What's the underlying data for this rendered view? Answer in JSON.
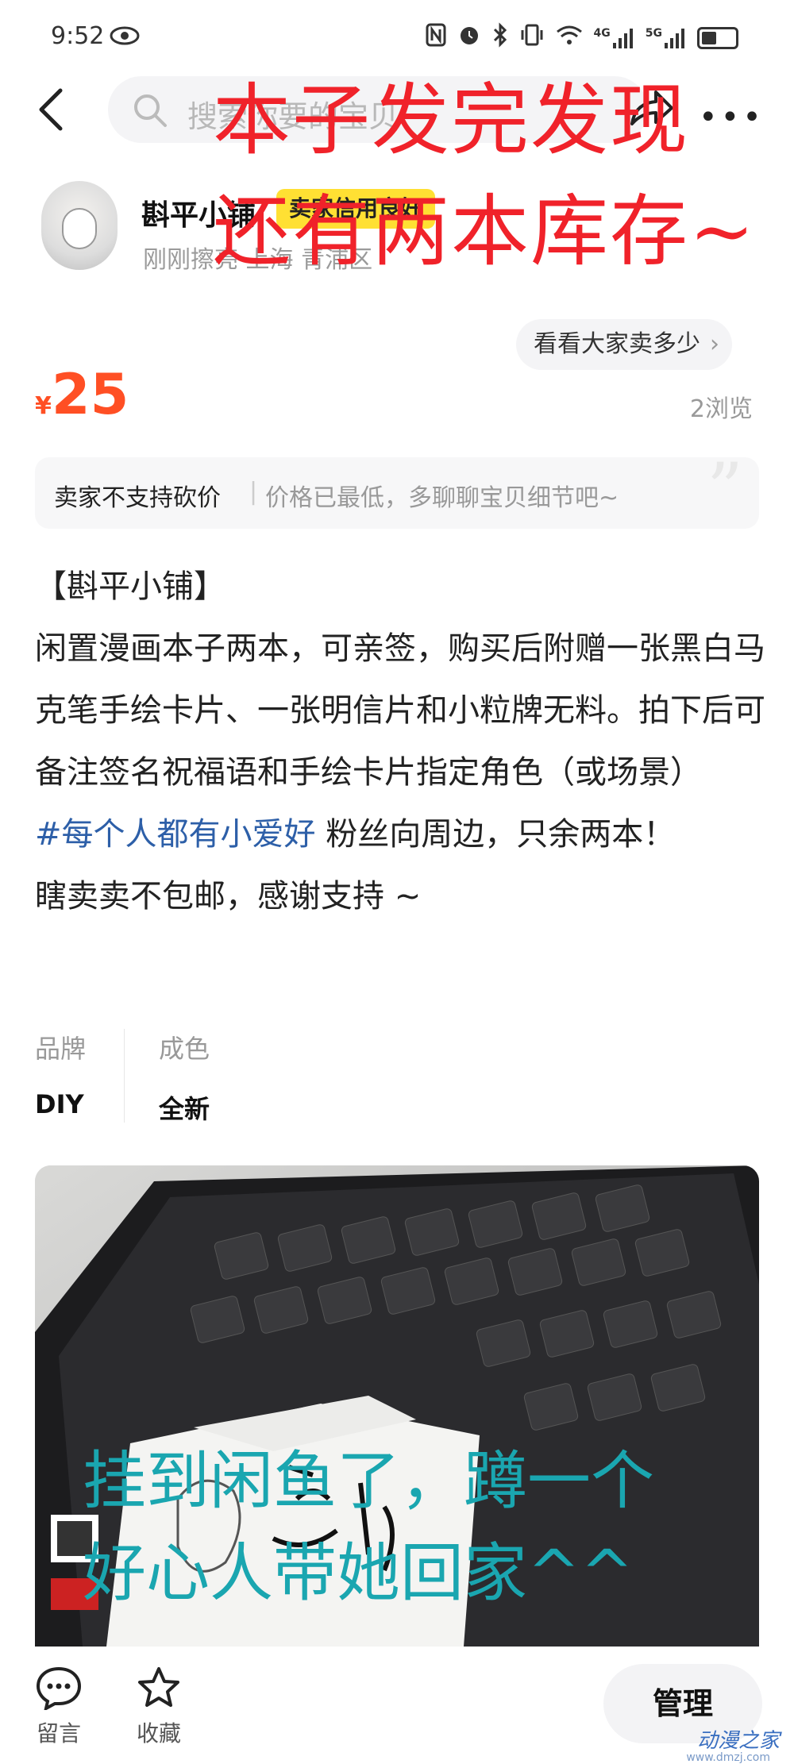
{
  "status_bar": {
    "time": "9:52",
    "right_icons": [
      "nfc-icon",
      "alarm-icon",
      "bluetooth-icon",
      "vibrate-icon",
      "wifi-icon",
      "signal-4g-icon",
      "signal-5g-icon",
      "battery-icon"
    ],
    "network_labels": [
      "4G",
      "5G"
    ]
  },
  "search": {
    "placeholder": "搜索你要的宝贝"
  },
  "overlay_text": {
    "line1": "本子发完发现",
    "line2": "还有两本库存~"
  },
  "seller": {
    "name": "斟平小铺",
    "badge": "卖家信用良好",
    "meta": "刚刚擦亮  上海 青浦区"
  },
  "compare_button": {
    "label": "看看大家卖多少"
  },
  "price": {
    "symbol": "¥",
    "value": "25"
  },
  "views": "2浏览",
  "bargain": {
    "main": "卖家不支持砍价",
    "sub": "价格已最低，多聊聊宝贝细节吧~"
  },
  "description": {
    "title": "【斟平小铺】",
    "body": "闲置漫画本子两本，可亲签，购买后附赠一张黑白马克笔手绘卡片、一张明信片和小粒牌无料。拍下后可备注签名祝福语和手绘卡片指定角色（或场景）",
    "hashtag": "#每个人都有小爱好",
    "tail1": " 粉丝向周边，只余两本！",
    "tail2": "瞎卖卖不包邮，感谢支持 ~"
  },
  "specs": [
    {
      "label": "品牌",
      "value": "DIY"
    },
    {
      "label": "成色",
      "value": "全新"
    }
  ],
  "photo_overlay": {
    "line1": "挂到闲鱼了，蹲一个",
    "line2": "好心人带她回家^^"
  },
  "bottom_bar": {
    "comment_label": "留言",
    "favorite_label": "收藏",
    "manage_label": "管理"
  },
  "watermark": {
    "text": "动漫之家",
    "sub": "www.dmzj.com"
  },
  "colors": {
    "price": "#ff4f24",
    "badge": "#ffe033",
    "hashtag": "#2d5fa8",
    "overlay_red": "#f0222a",
    "overlay_cyan": "#1aa6b0"
  }
}
